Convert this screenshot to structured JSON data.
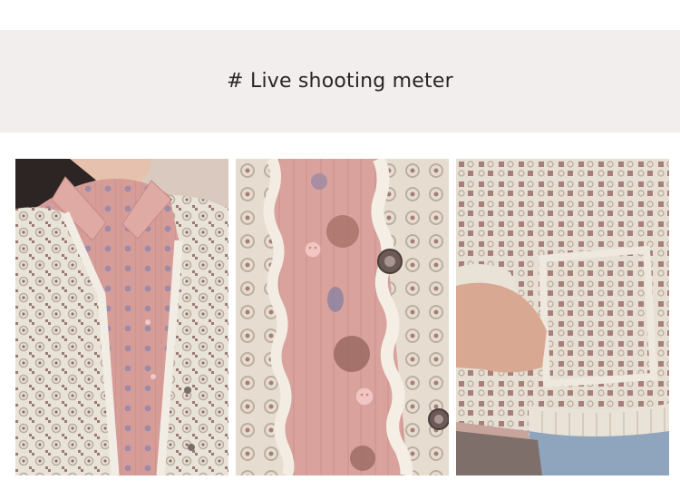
{
  "banner": {
    "title": "# Live shooting meter"
  },
  "photos": [
    {
      "subject": "woman-wearing-crochet-vest-over-pink-shirt"
    },
    {
      "subject": "close-up-crochet-edge-and-buttons"
    },
    {
      "subject": "close-up-crochet-pocket-and-hand"
    }
  ],
  "colors": {
    "banner_bg": "#f1eeed",
    "shirt_pink": "#d49a96",
    "crochet_cream": "#e8e1d6",
    "jeans_blue": "#8fa5bd"
  }
}
